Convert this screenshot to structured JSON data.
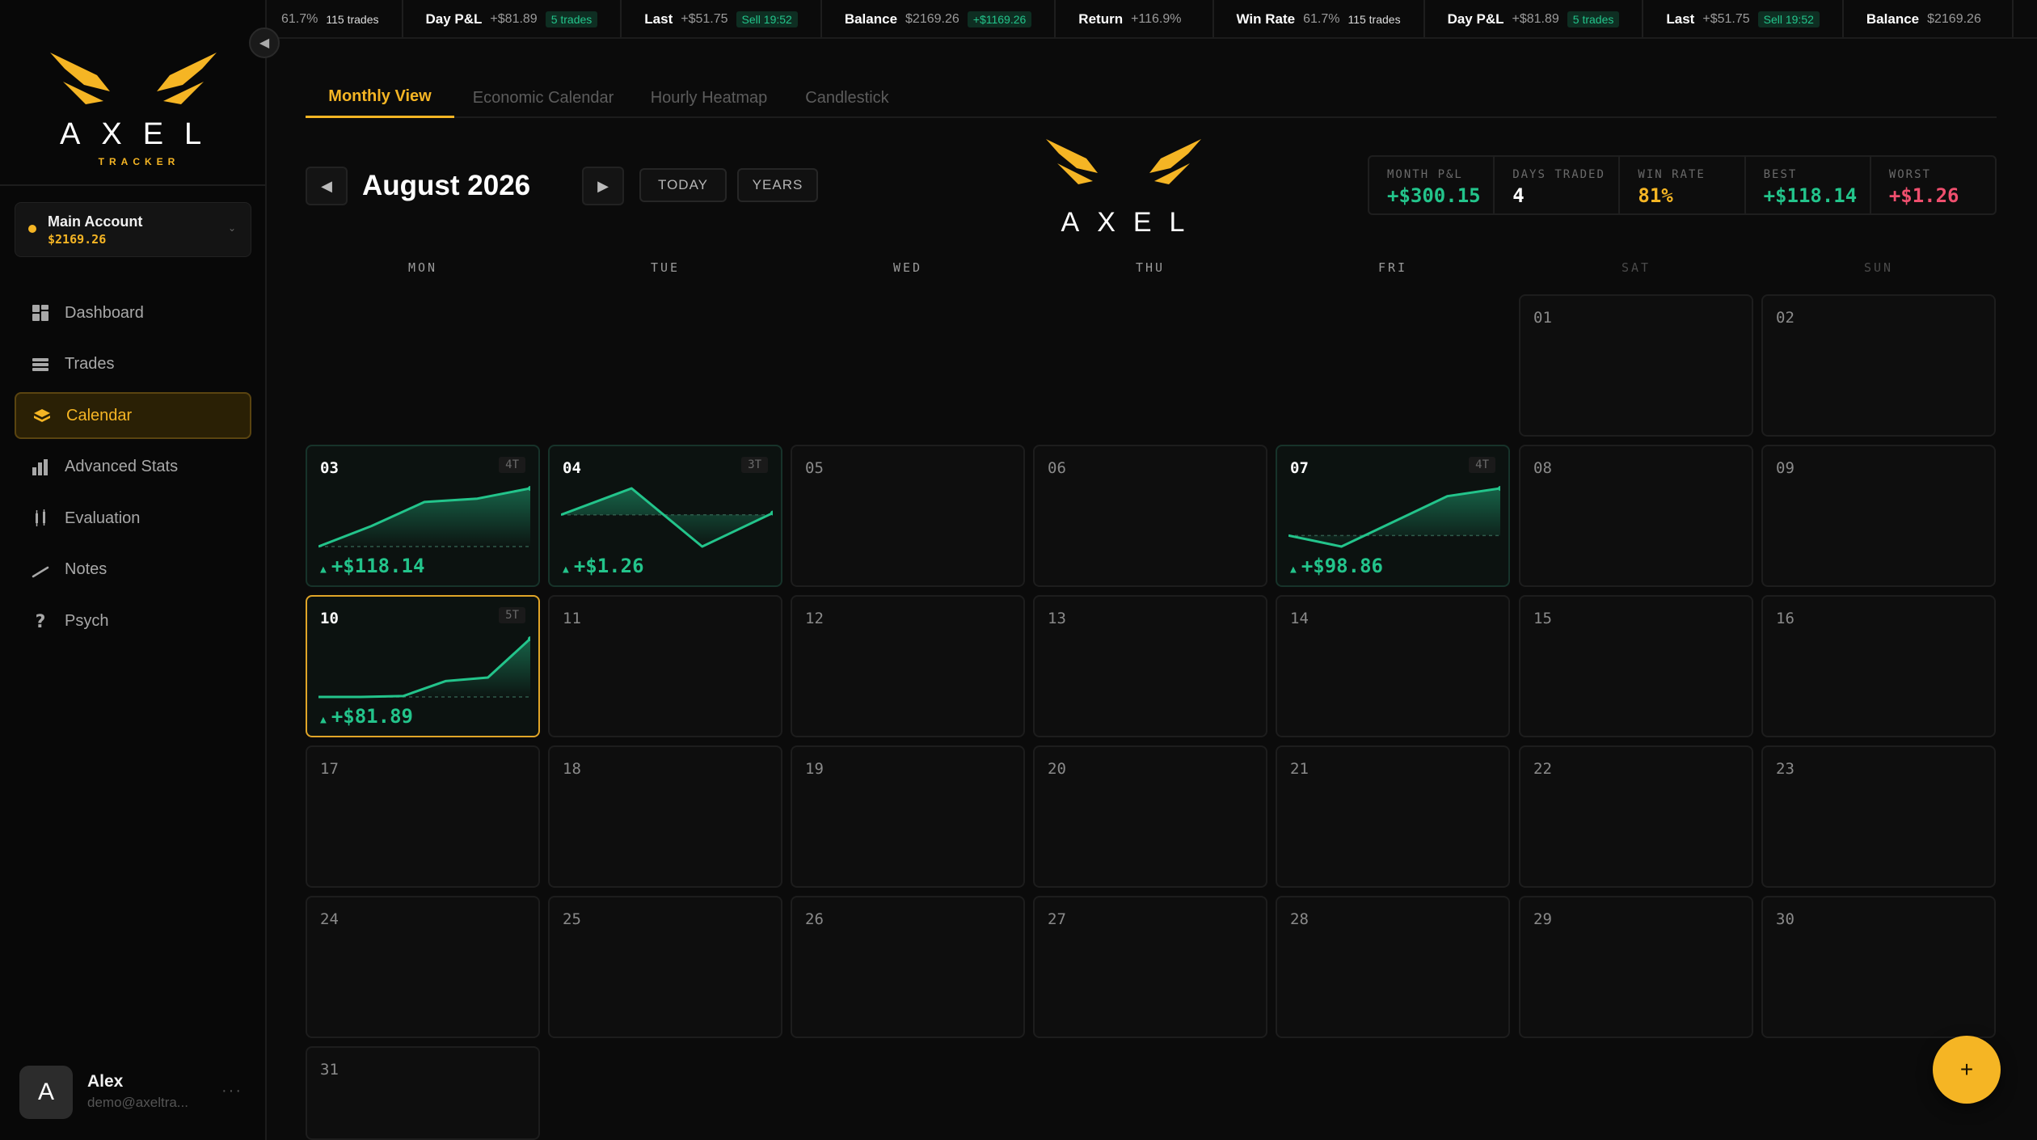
{
  "app": {
    "logo_text": "AXEL",
    "logo_sub": "TRACKER",
    "colors": {
      "accent": "#f5b524",
      "profit": "#23c48b",
      "loss": "#ef4f6e",
      "background": "#0b0b0b"
    }
  },
  "ticker": [
    {
      "label": "",
      "value": "61.7%",
      "badge": "115 trades",
      "badge_style": "plain"
    },
    {
      "label": "Day P&L",
      "value": "+$81.89",
      "badge": "5 trades",
      "badge_style": "green"
    },
    {
      "label": "Last",
      "value": "+$51.75",
      "badge": "Sell 19:52",
      "badge_style": "green"
    },
    {
      "label": "Balance",
      "value": "$2169.26",
      "badge": "+$1169.26",
      "badge_style": "green"
    },
    {
      "label": "Return",
      "value": "+116.9%",
      "badge": "",
      "badge_style": "none"
    },
    {
      "label": "Win Rate",
      "value": "61.7%",
      "badge": "115 trades",
      "badge_style": "plain"
    },
    {
      "label": "Day P&L",
      "value": "+$81.89",
      "badge": "5 trades",
      "badge_style": "green"
    },
    {
      "label": "Last",
      "value": "+$51.75",
      "badge": "Sell 19:52",
      "badge_style": "green"
    },
    {
      "label": "Balance",
      "value": "$2169.26",
      "badge": "",
      "badge_style": "none"
    }
  ],
  "sidebar": {
    "account": {
      "name": "Main Account",
      "balance": "$2169.26"
    },
    "items": [
      {
        "label": "Dashboard",
        "icon": "dashboard-icon",
        "active": false
      },
      {
        "label": "Trades",
        "icon": "trades-icon",
        "active": false
      },
      {
        "label": "Calendar",
        "icon": "calendar-icon",
        "active": true
      },
      {
        "label": "Advanced Stats",
        "icon": "stats-icon",
        "active": false
      },
      {
        "label": "Evaluation",
        "icon": "evaluation-icon",
        "active": false
      },
      {
        "label": "Notes",
        "icon": "notes-icon",
        "active": false
      },
      {
        "label": "Psych",
        "icon": "help-icon",
        "active": false
      }
    ],
    "user": {
      "initial": "A",
      "name": "Alex",
      "email": "demo@axeltra..."
    }
  },
  "tabs": [
    {
      "label": "Monthly View",
      "active": true
    },
    {
      "label": "Economic Calendar",
      "active": false
    },
    {
      "label": "Hourly Heatmap",
      "active": false
    },
    {
      "label": "Candlestick",
      "active": false
    }
  ],
  "header": {
    "month": "August 2026",
    "today_label": "TODAY",
    "years_label": "YEARS"
  },
  "stats": [
    {
      "label": "MONTH P&L",
      "value": "+$300.15",
      "tone": "profit"
    },
    {
      "label": "DAYS TRADED",
      "value": "4",
      "tone": "neutral"
    },
    {
      "label": "WIN RATE",
      "value": "81%",
      "tone": "accent"
    },
    {
      "label": "BEST",
      "value": "+$118.14",
      "tone": "profit"
    },
    {
      "label": "WORST",
      "value": "+$1.26",
      "tone": "loss"
    }
  ],
  "weekdays": [
    "MON",
    "TUE",
    "WED",
    "THU",
    "FRI",
    "SAT",
    "SUN"
  ],
  "calendar": {
    "first_weekday_index": 5,
    "days_in_month": 31,
    "today": 10,
    "traded": {
      "03": {
        "trades": "4T",
        "pnl": "+$118.14",
        "series": [
          0,
          12,
          26,
          28,
          34
        ]
      },
      "04": {
        "trades": "3T",
        "pnl": "+$1.26",
        "series": [
          0,
          15,
          -18,
          1
        ]
      },
      "07": {
        "trades": "4T",
        "pnl": "+$98.86",
        "series": [
          0,
          -7,
          9,
          25,
          30
        ]
      },
      "10": {
        "trades": "5T",
        "pnl": "+$81.89",
        "series": [
          0,
          0,
          0.5,
          9,
          11,
          33
        ]
      }
    }
  }
}
